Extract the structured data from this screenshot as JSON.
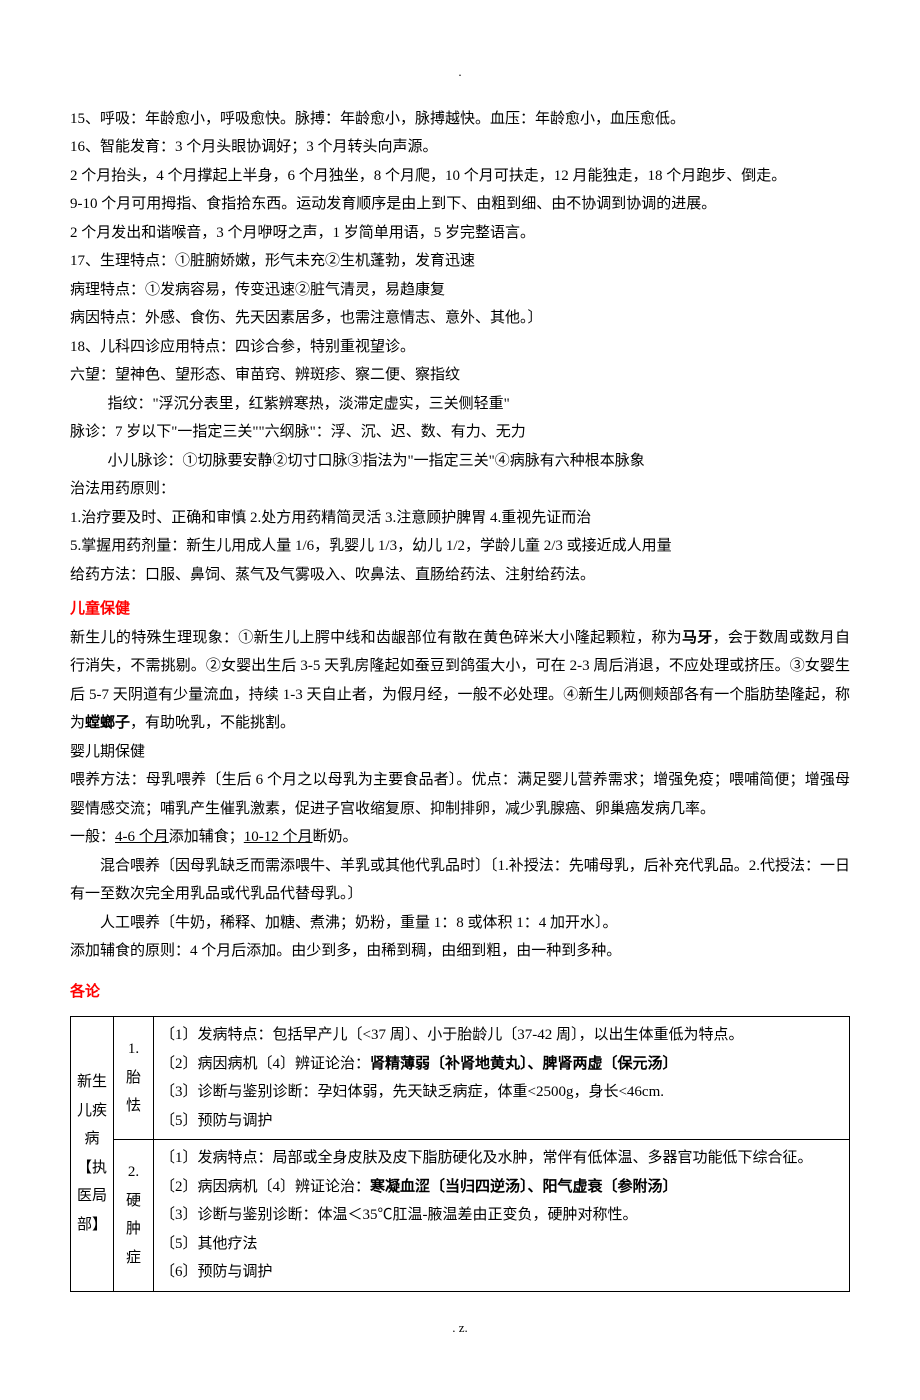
{
  "top_marker": ".",
  "body": {
    "p1": "15、呼吸：年龄愈小，呼吸愈快。脉搏：年龄愈小，脉搏越快。血压：年龄愈小，血压愈低。",
    "p2": "16、智能发育：3 个月头眼协调好；3 个月转头向声源。",
    "p3": "2 个月抬头，4 个月撑起上半身，6 个月独坐，8 个月爬，10 个月可扶走，12 月能独走，18 个月跑步、倒走。",
    "p4": "9-10 个月可用拇指、食指拾东西。运动发育顺序是由上到下、由粗到细、由不协调到协调的进展。",
    "p5": "2 个月发出和谐喉音，3 个月咿呀之声，1 岁简单用语，5 岁完整语言。",
    "p6": "17、生理特点：①脏腑娇嫩，形气未充②生机蓬勃，发育迅速",
    "p7": "病理特点：①发病容易，传变迅速②脏气清灵，易趋康复",
    "p8": "病因特点：外感、食伤、先天因素居多，也需注意情志、意外、其他。〕",
    "p9": "18、儿科四诊应用特点：四诊合参，特别重视望诊。",
    "p10": "六望：望神色、望形态、审苗窍、辨斑疹、察二便、察指纹",
    "p11": "指纹：\"浮沉分表里，红紫辨寒热，淡滞定虚实，三关侧轻重\"",
    "p12": "脉诊：7 岁以下\"一指定三关\"\"六纲脉\"：浮、沉、迟、数、有力、无力",
    "p13": "小儿脉诊：①切脉要安静②切寸口脉③指法为\"一指定三关\"④病脉有六种根本脉象",
    "p14": "治法用药原则：",
    "p15": "1.治疗要及时、正确和审慎        2.处方用药精简灵活 3.注意顾护脾胃        4.重视先证而治",
    "p16": "5.掌握用药剂量：新生儿用成人量 1/6，乳婴儿 1/3，幼儿 1/2，学龄儿童 2/3 或接近成人用量",
    "p17": "给药方法：口服、鼻饲、蒸气及气雾吸入、吹鼻法、直肠给药法、注射给药法。",
    "h1": "儿童保健",
    "p18_pre": "新生儿的特殊生理现象：①新生儿上腭中线和齿龈部位有散在黄色碎米大小隆起颗粒，称为",
    "p18_strong": "马牙",
    "p18_post": "，会于数周或数月自行消失，不需挑剔。②女婴出生后 3-5 天乳房隆起如蚕豆到鸽蛋大小，可在 2-3 周后消退，不应处理或挤压。③女婴生后 5-7 天阴道有少量流血，持续 1-3 天自止者，为假月经，一般不必处理。④新生儿两侧颊部各有一个脂肪垫隆起，称为",
    "p18_strong2": "螳螂子",
    "p18_post2": "，有助吮乳，不能挑割。",
    "p19": "婴儿期保健",
    "p20": "喂养方法：母乳喂养〔生后 6 个月之以母乳为主要食品者〕。优点：满足婴儿营养需求；增强免疫；喂哺简便；增强母婴情感交流；哺乳产生催乳激素，促进子宫收缩复原、抑制排卵，减少乳腺癌、卵巢癌发病几率。",
    "p21_pre": "一般：",
    "p21_u1": "4-6 个月",
    "p21_mid": "添加辅食；",
    "p21_u2": "10-12 个月",
    "p21_post": "断奶。",
    "p22": "混合喂养〔因母乳缺乏而需添喂牛、羊乳或其他代乳品时〕〔1.补授法：先哺母乳，后补充代乳品。2.代授法：一日有一至数次完全用乳品或代乳品代替母乳。〕",
    "p23": "人工喂养〔牛奶，稀释、加糖、煮沸；奶粉，重量 1：8 或体积 1：4 加开水〕。",
    "p24": "添加辅食的原则：4 个月后添加。由少到多，由稀到稠，由细到粗，由一种到多种。",
    "h2": "各论"
  },
  "table": {
    "row1": {
      "header": "新生儿疾病【执医局部】",
      "sub": "1. 胎怯",
      "lines": [
        "〔1〕发病特点：包括早产儿〔<37 周〕、小于胎龄儿〔37-42 周〕，以出生体重低为特点。",
        "〔2〕病因病机〔4〕辨证论治：肾精薄弱〔补肾地黄丸〕、脾肾两虚〔保元汤〕",
        "〔3〕诊断与鉴别诊断：孕妇体弱，先天缺乏病症，体重<2500g，身长<46cm.",
        "〔5〕预防与调护"
      ]
    },
    "row2": {
      "sub": "2. 硬肿症",
      "lines": [
        "〔1〕发病特点：局部或全身皮肤及皮下脂肪硬化及水肿，常伴有低体温、多器官功能低下综合征。",
        "〔2〕病因病机〔4〕辨证论治：寒凝血涩〔当归四逆汤〕、阳气虚衰〔参附汤〕",
        "〔3〕诊断与鉴别诊断：体温＜35℃肛温-腋温差由正变负，硬肿对称性。",
        "〔5〕其他疗法",
        "〔6〕预防与调护"
      ]
    }
  },
  "footer": ".          z."
}
